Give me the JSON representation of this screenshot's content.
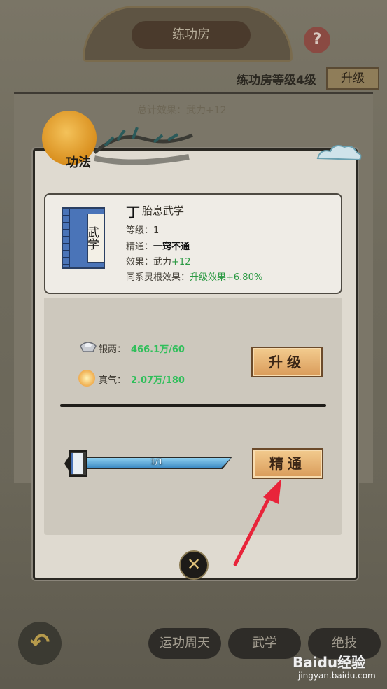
{
  "background": {
    "title": "练功房",
    "help_icon": "question-icon",
    "help_label": "?",
    "level_text": "练功房等级4级",
    "upgrade_label": "升级",
    "total_effect": "总计效果：武力+12",
    "back_icon": "back-arrow-icon",
    "back_label": "↶",
    "tabs": [
      "运功周天",
      "武学",
      "绝技"
    ]
  },
  "modal": {
    "title": "功法",
    "book_text": "武学",
    "skill": {
      "grade": "丁",
      "name": "胎息武学",
      "level_label": "等级：",
      "level_value": "1",
      "mastery_label": "精通：",
      "mastery_value": "一窍不通",
      "effect_label": "效果：",
      "effect_text": "武力",
      "effect_bonus": "+12",
      "root_label": "同系灵根效果：",
      "root_value": "升级效果+6.80%"
    },
    "resources": {
      "silver_label": "银两：",
      "silver_value": "466.1万/60",
      "qi_label": "真气：",
      "qi_value": "2.07万/180"
    },
    "upgrade_button": "升级",
    "mastery_button": "精通",
    "progress": {
      "fraction": 1.0,
      "text": "1/1"
    },
    "close_icon": "close-icon",
    "close_label": "✕"
  },
  "watermark": {
    "text": "Baidu经验",
    "url": "jingyan.baidu.com"
  },
  "colors": {
    "green": "#2fbf5a",
    "button": "#e0a86a",
    "accent_red": "#e8243a"
  }
}
